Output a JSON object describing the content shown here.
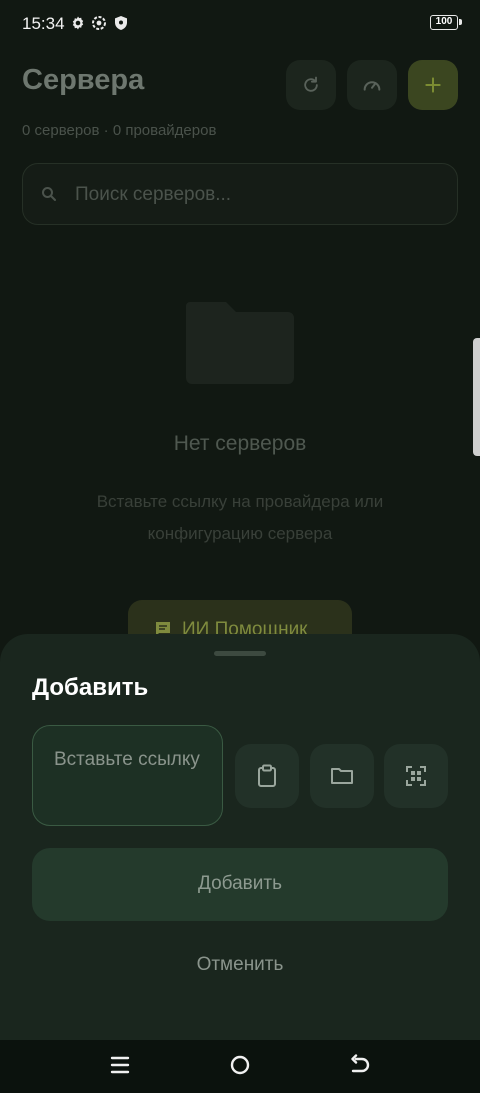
{
  "status_bar": {
    "time": "15:34",
    "battery": "100",
    "icons": [
      "gear-icon",
      "settings-icon",
      "shield-icon"
    ]
  },
  "header": {
    "title": "Сервера",
    "subtitle": "0 серверов · 0 провайдеров",
    "actions": [
      "refresh-icon",
      "speedometer-icon",
      "plus-icon"
    ]
  },
  "search": {
    "placeholder": "Поиск серверов..."
  },
  "empty_state": {
    "icon": "folder-icon",
    "title": "Нет серверов",
    "description": "Вставьте ссылку на провайдера или конфигурацию сервера",
    "ai_button_label": "ИИ Помощник"
  },
  "sheet": {
    "title": "Добавить",
    "link_placeholder": "Вставьте ссылку",
    "icon_buttons": [
      "clipboard-icon",
      "folder-icon",
      "qr-scan-icon"
    ],
    "add_label": "Добавить",
    "cancel_label": "Отменить"
  },
  "navbar": {
    "items": [
      "menu-icon",
      "home-icon",
      "back-icon"
    ]
  },
  "colors": {
    "accent": "#a4c639",
    "sheet_bg": "#1a261e",
    "background": "#111812"
  }
}
